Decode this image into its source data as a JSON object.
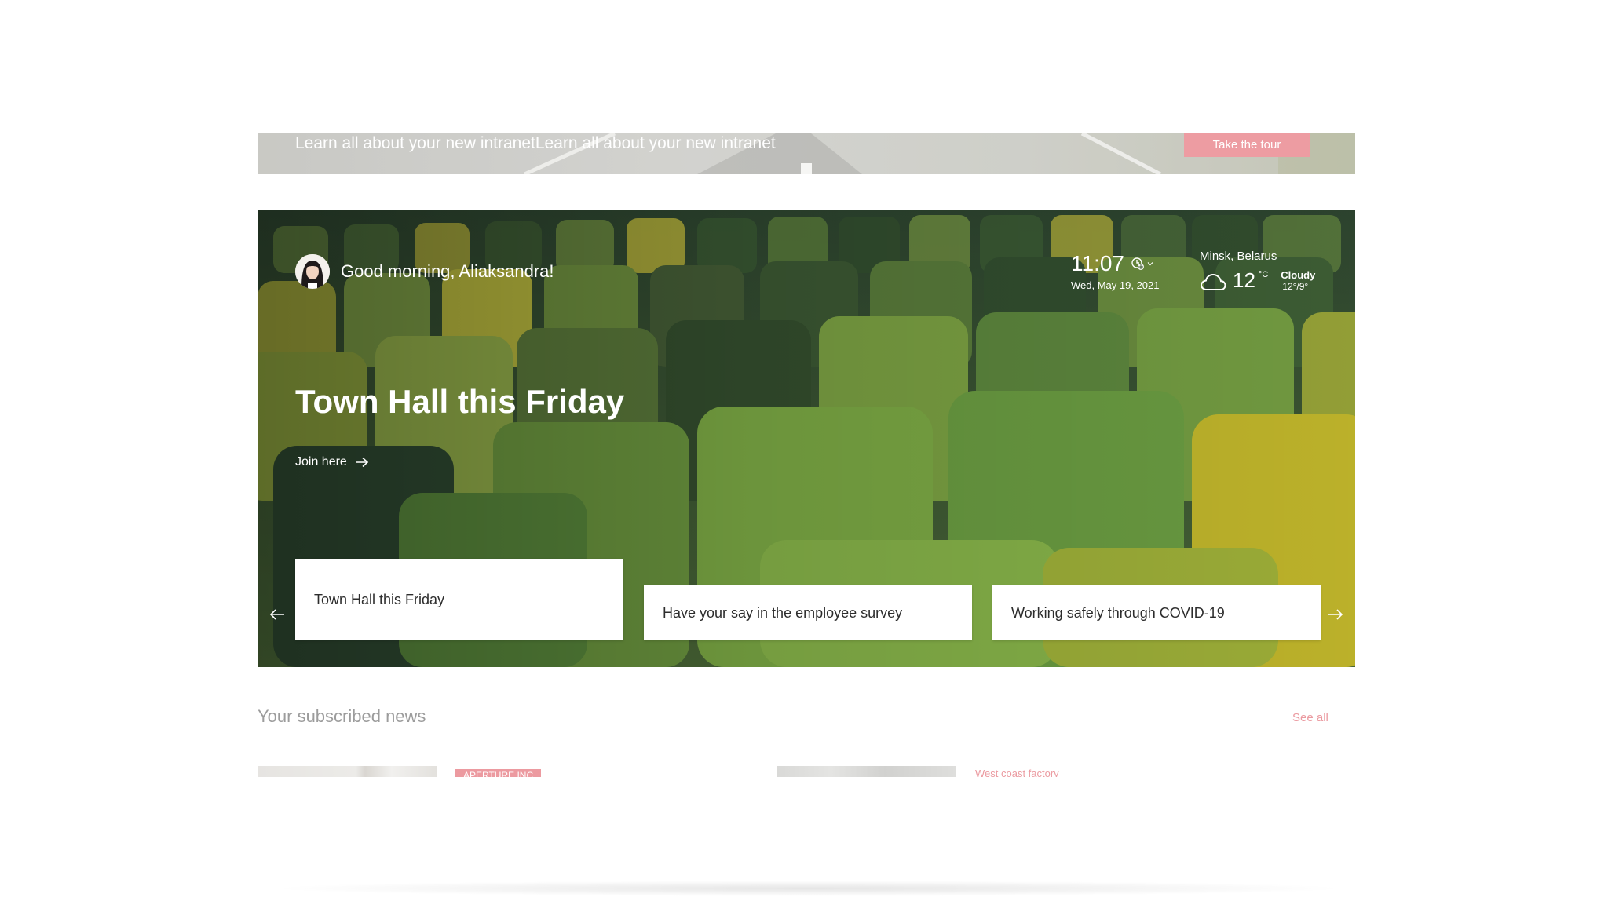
{
  "banner": {
    "text": "Learn all about your new intranetLearn all about your new intranet",
    "button_label": "Take the tour"
  },
  "hero": {
    "greeting": "Good morning, Aliaksandra!",
    "clock": {
      "time": "11:07",
      "date": "Wed, May 19, 2021"
    },
    "weather": {
      "location": "Minsk, Belarus",
      "temperature": "12",
      "unit": "°C",
      "condition": "Cloudy",
      "range": "12°/9°"
    },
    "title": "Town Hall this Friday",
    "link_label": "Join here",
    "cards": [
      {
        "label": "Town Hall this Friday"
      },
      {
        "label": "Have your say in the employee survey"
      },
      {
        "label": "Working safely through COVID-19"
      }
    ]
  },
  "news": {
    "heading": "Your subscribed news",
    "see_all": "See all",
    "items": [
      {
        "tag": "APERTURE INC"
      },
      {
        "tag": "West coast factory"
      }
    ]
  },
  "colors": {
    "accent": "#ed9ca2",
    "muted_heading": "#9c9c9c",
    "card_text": "#2d2d2d"
  }
}
